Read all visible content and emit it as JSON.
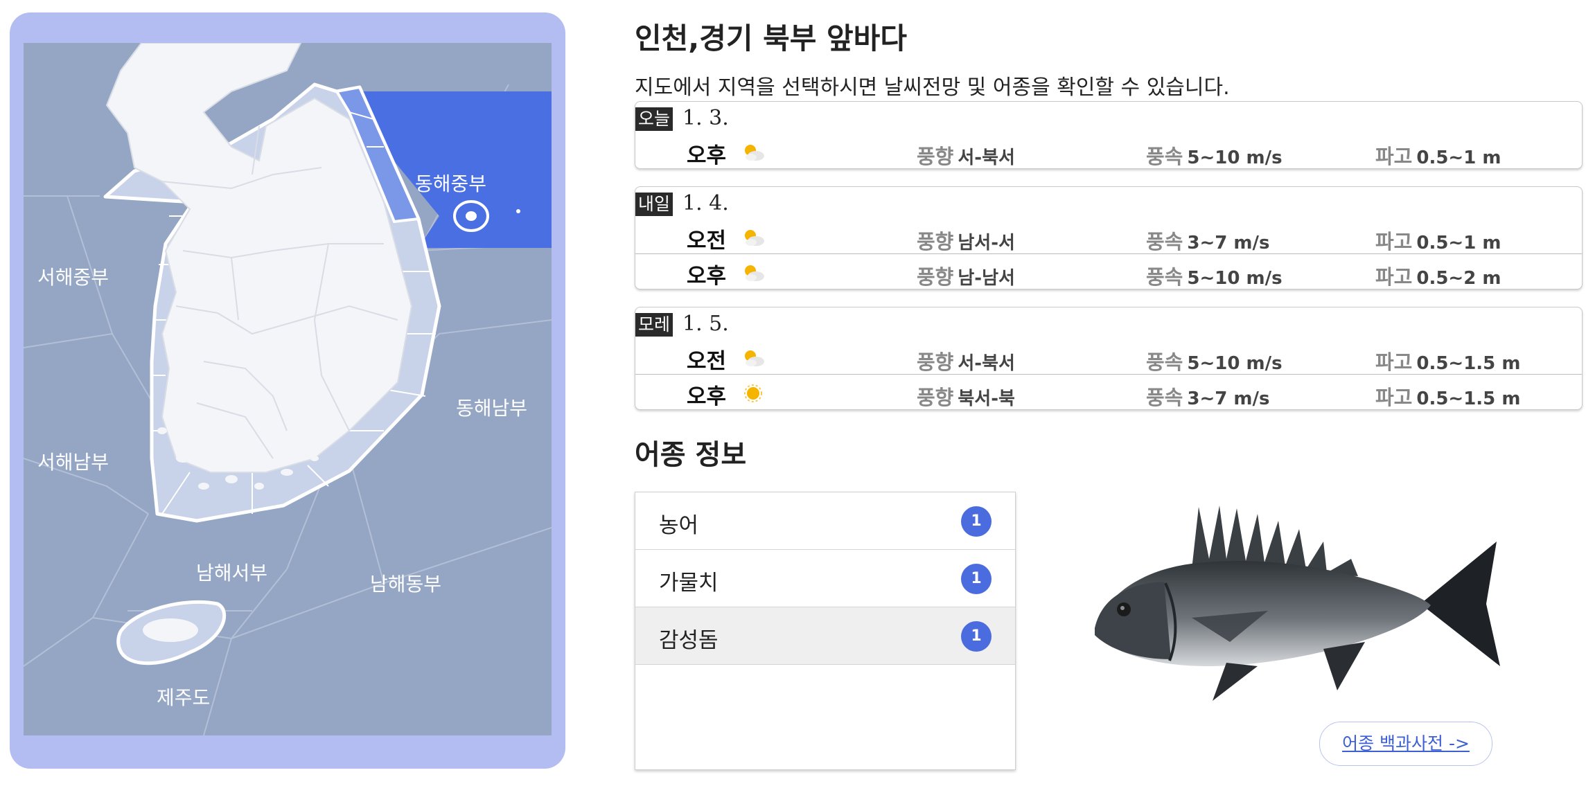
{
  "map": {
    "regions": [
      {
        "key": "west-central",
        "label": "서해중부"
      },
      {
        "key": "west-south",
        "label": "서해남부"
      },
      {
        "key": "south-west",
        "label": "남해서부"
      },
      {
        "key": "jeju",
        "label": "제주도"
      },
      {
        "key": "east-central",
        "label": "동해중부"
      },
      {
        "key": "east-south",
        "label": "동해남부"
      },
      {
        "key": "south-east",
        "label": "남해동부"
      }
    ],
    "selected_region": "동해중부",
    "colors": {
      "sea": "#94a6c4",
      "land": "#f4f5f8",
      "coastal": "#c8d2e8",
      "selected": "#4a6fe3",
      "frame": "#b3bdf2"
    }
  },
  "header": {
    "title": "인천,경기 북부 앞바다",
    "subtitle": "지도에서 지역을 선택하시면 날씨전망 및 어종을 확인할 수 있습니다."
  },
  "forecast": [
    {
      "badge": "오늘",
      "date": "1. 3.",
      "rows": [
        {
          "period": "오후",
          "icon": "partly-cloudy-icon",
          "wind_dir_label": "풍향",
          "wind_dir": "서-북서",
          "wind_speed_label": "풍속",
          "wind_speed": "5~10 m/s",
          "wave_label": "파고",
          "wave": "0.5~1 m"
        }
      ]
    },
    {
      "badge": "내일",
      "date": "1. 4.",
      "rows": [
        {
          "period": "오전",
          "icon": "partly-cloudy-icon",
          "wind_dir_label": "풍향",
          "wind_dir": "남서-서",
          "wind_speed_label": "풍속",
          "wind_speed": "3~7 m/s",
          "wave_label": "파고",
          "wave": "0.5~1 m"
        },
        {
          "period": "오후",
          "icon": "partly-cloudy-icon",
          "wind_dir_label": "풍향",
          "wind_dir": "남-남서",
          "wind_speed_label": "풍속",
          "wind_speed": "5~10 m/s",
          "wave_label": "파고",
          "wave": "0.5~2 m"
        }
      ]
    },
    {
      "badge": "모레",
      "date": "1. 5.",
      "rows": [
        {
          "period": "오전",
          "icon": "partly-cloudy-icon",
          "wind_dir_label": "풍향",
          "wind_dir": "서-북서",
          "wind_speed_label": "풍속",
          "wind_speed": "5~10 m/s",
          "wave_label": "파고",
          "wave": "0.5~1.5 m"
        },
        {
          "period": "오후",
          "icon": "sunny-icon",
          "wind_dir_label": "풍향",
          "wind_dir": "북서-북",
          "wind_speed_label": "풍속",
          "wind_speed": "3~7 m/s",
          "wave_label": "파고",
          "wave": "0.5~1.5 m"
        }
      ]
    }
  ],
  "fish": {
    "title": "어종 정보",
    "items": [
      {
        "name": "농어",
        "count": "1"
      },
      {
        "name": "가물치",
        "count": "1"
      },
      {
        "name": "감성돔",
        "count": "1"
      }
    ],
    "selected": "감성돔",
    "image_icon": "black-seabream-photo",
    "dict_link": "어종 백과사전 ->"
  }
}
